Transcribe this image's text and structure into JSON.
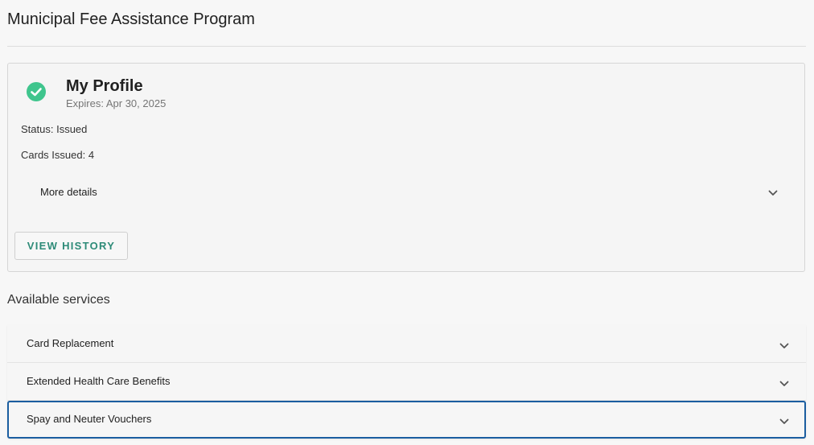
{
  "page": {
    "title": "Municipal Fee Assistance Program"
  },
  "profile": {
    "icon": "check-circle-icon",
    "title": "My Profile",
    "expires": "Expires: Apr 30, 2025",
    "status": "Status: Issued",
    "cards_issued": "Cards Issued: 4",
    "more_details_label": "More details",
    "view_history_label": "VIEW HISTORY"
  },
  "services": {
    "heading": "Available services",
    "items": [
      {
        "label": "Card Replacement"
      },
      {
        "label": "Extended Health Care Benefits"
      },
      {
        "label": "Spay and Neuter Vouchers"
      }
    ]
  },
  "colors": {
    "accent_green": "#3fc58d",
    "button_text": "#2e8b78",
    "focus_border": "#1b5ea0"
  }
}
